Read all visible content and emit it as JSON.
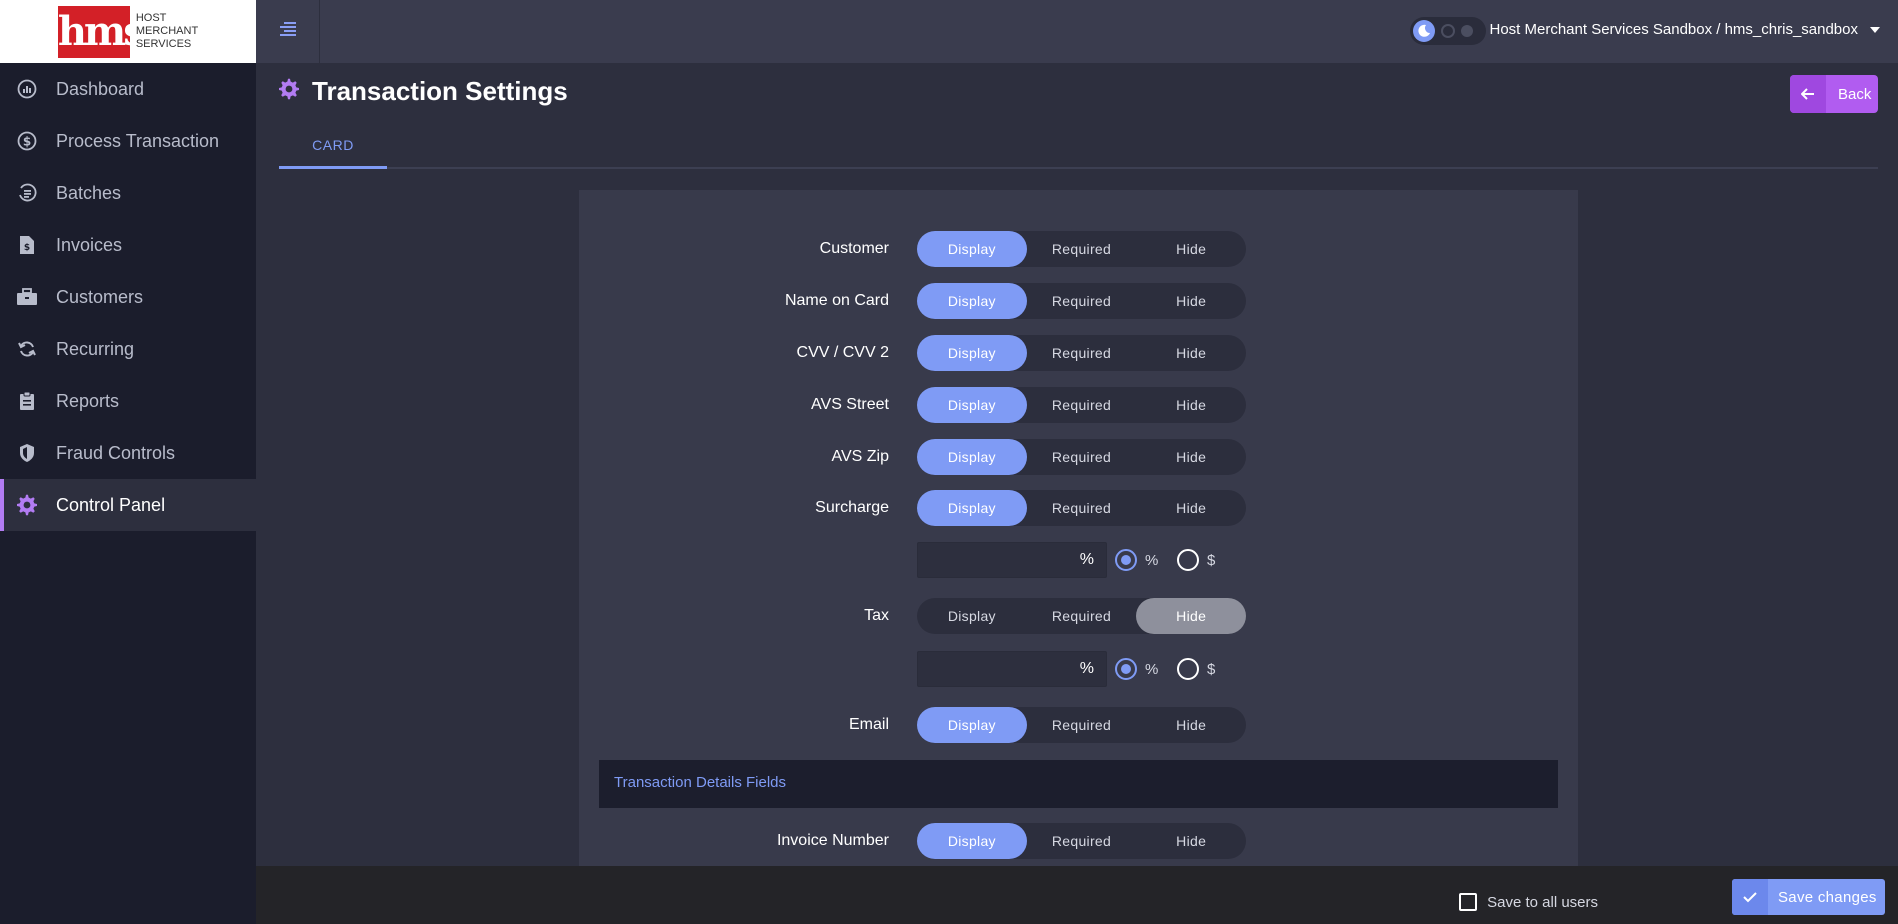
{
  "logo": {
    "mark": "hms",
    "line1": "HOST",
    "line2": "MERCHANT",
    "line3": "SERVICES"
  },
  "sidebar": {
    "items": [
      {
        "label": "Dashboard",
        "icon": "dashboard-gauge-icon"
      },
      {
        "label": "Process Transaction",
        "icon": "dollar-cycle-icon"
      },
      {
        "label": "Batches",
        "icon": "batches-icon"
      },
      {
        "label": "Invoices",
        "icon": "invoice-file-icon"
      },
      {
        "label": "Customers",
        "icon": "briefcase-icon"
      },
      {
        "label": "Recurring",
        "icon": "recurring-sync-icon"
      },
      {
        "label": "Reports",
        "icon": "clipboard-icon"
      },
      {
        "label": "Fraud Controls",
        "icon": "shield-icon"
      },
      {
        "label": "Control Panel",
        "icon": "gear-icon",
        "active": true
      }
    ]
  },
  "header": {
    "account": "Host Merchant Services Sandbox / hms_chris_sandbox"
  },
  "page": {
    "title": "Transaction Settings",
    "back_label": "Back",
    "tab_card": "CARD"
  },
  "options": {
    "display": "Display",
    "required": "Required",
    "hide": "Hide"
  },
  "fields": {
    "customer": {
      "label": "Customer",
      "selected": "Display"
    },
    "name_on_card": {
      "label": "Name on Card",
      "selected": "Display"
    },
    "cvv": {
      "label": "CVV / CVV 2",
      "selected": "Display"
    },
    "avs_street": {
      "label": "AVS Street",
      "selected": "Display"
    },
    "avs_zip": {
      "label": "AVS Zip",
      "selected": "Display"
    },
    "surcharge": {
      "label": "Surcharge",
      "selected": "Display"
    },
    "tax": {
      "label": "Tax",
      "selected": "Hide"
    },
    "email": {
      "label": "Email",
      "selected": "Display"
    },
    "invoice_number": {
      "label": "Invoice Number",
      "selected": "Display"
    }
  },
  "surcharge_amount": {
    "suffix": "%",
    "radio_percent": "%",
    "radio_dollar": "$",
    "selected": "%"
  },
  "tax_amount": {
    "suffix": "%",
    "radio_percent": "%",
    "radio_dollar": "$",
    "selected": "%"
  },
  "section": {
    "transaction_details": "Transaction Details Fields"
  },
  "footer": {
    "save_all_label": "Save to all users",
    "save_label": "Save changes"
  },
  "colors": {
    "accent": "#7f9bf5",
    "purple": "#b15cf0",
    "sidebar_bg": "#1b1d2c",
    "content_bg": "#2d2f3e",
    "panel_bg": "#383a4b"
  }
}
